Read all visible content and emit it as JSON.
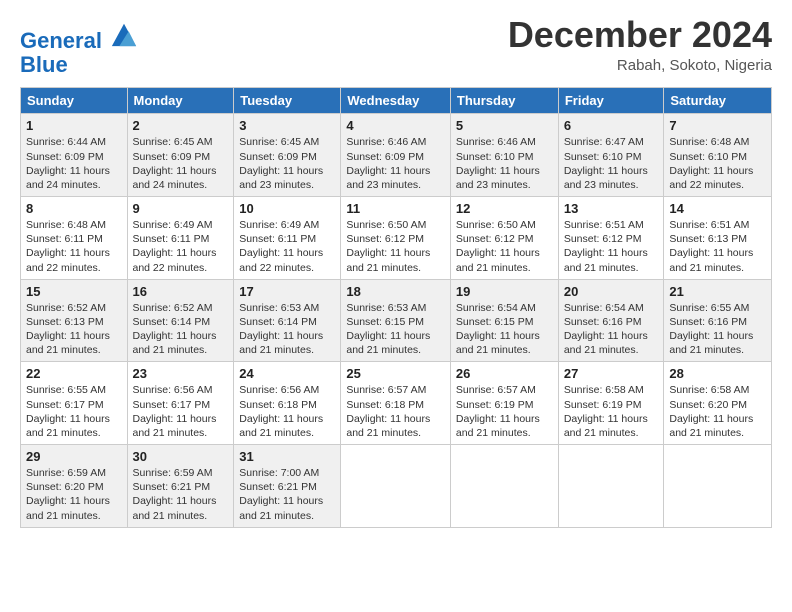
{
  "header": {
    "logo_line1": "General",
    "logo_line2": "Blue",
    "month": "December 2024",
    "location": "Rabah, Sokoto, Nigeria"
  },
  "days_of_week": [
    "Sunday",
    "Monday",
    "Tuesday",
    "Wednesday",
    "Thursday",
    "Friday",
    "Saturday"
  ],
  "weeks": [
    [
      {
        "day": "1",
        "sunrise": "6:44 AM",
        "sunset": "6:09 PM",
        "daylight": "11 hours and 24 minutes."
      },
      {
        "day": "2",
        "sunrise": "6:45 AM",
        "sunset": "6:09 PM",
        "daylight": "11 hours and 24 minutes."
      },
      {
        "day": "3",
        "sunrise": "6:45 AM",
        "sunset": "6:09 PM",
        "daylight": "11 hours and 23 minutes."
      },
      {
        "day": "4",
        "sunrise": "6:46 AM",
        "sunset": "6:09 PM",
        "daylight": "11 hours and 23 minutes."
      },
      {
        "day": "5",
        "sunrise": "6:46 AM",
        "sunset": "6:10 PM",
        "daylight": "11 hours and 23 minutes."
      },
      {
        "day": "6",
        "sunrise": "6:47 AM",
        "sunset": "6:10 PM",
        "daylight": "11 hours and 23 minutes."
      },
      {
        "day": "7",
        "sunrise": "6:48 AM",
        "sunset": "6:10 PM",
        "daylight": "11 hours and 22 minutes."
      }
    ],
    [
      {
        "day": "8",
        "sunrise": "6:48 AM",
        "sunset": "6:11 PM",
        "daylight": "11 hours and 22 minutes."
      },
      {
        "day": "9",
        "sunrise": "6:49 AM",
        "sunset": "6:11 PM",
        "daylight": "11 hours and 22 minutes."
      },
      {
        "day": "10",
        "sunrise": "6:49 AM",
        "sunset": "6:11 PM",
        "daylight": "11 hours and 22 minutes."
      },
      {
        "day": "11",
        "sunrise": "6:50 AM",
        "sunset": "6:12 PM",
        "daylight": "11 hours and 21 minutes."
      },
      {
        "day": "12",
        "sunrise": "6:50 AM",
        "sunset": "6:12 PM",
        "daylight": "11 hours and 21 minutes."
      },
      {
        "day": "13",
        "sunrise": "6:51 AM",
        "sunset": "6:12 PM",
        "daylight": "11 hours and 21 minutes."
      },
      {
        "day": "14",
        "sunrise": "6:51 AM",
        "sunset": "6:13 PM",
        "daylight": "11 hours and 21 minutes."
      }
    ],
    [
      {
        "day": "15",
        "sunrise": "6:52 AM",
        "sunset": "6:13 PM",
        "daylight": "11 hours and 21 minutes."
      },
      {
        "day": "16",
        "sunrise": "6:52 AM",
        "sunset": "6:14 PM",
        "daylight": "11 hours and 21 minutes."
      },
      {
        "day": "17",
        "sunrise": "6:53 AM",
        "sunset": "6:14 PM",
        "daylight": "11 hours and 21 minutes."
      },
      {
        "day": "18",
        "sunrise": "6:53 AM",
        "sunset": "6:15 PM",
        "daylight": "11 hours and 21 minutes."
      },
      {
        "day": "19",
        "sunrise": "6:54 AM",
        "sunset": "6:15 PM",
        "daylight": "11 hours and 21 minutes."
      },
      {
        "day": "20",
        "sunrise": "6:54 AM",
        "sunset": "6:16 PM",
        "daylight": "11 hours and 21 minutes."
      },
      {
        "day": "21",
        "sunrise": "6:55 AM",
        "sunset": "6:16 PM",
        "daylight": "11 hours and 21 minutes."
      }
    ],
    [
      {
        "day": "22",
        "sunrise": "6:55 AM",
        "sunset": "6:17 PM",
        "daylight": "11 hours and 21 minutes."
      },
      {
        "day": "23",
        "sunrise": "6:56 AM",
        "sunset": "6:17 PM",
        "daylight": "11 hours and 21 minutes."
      },
      {
        "day": "24",
        "sunrise": "6:56 AM",
        "sunset": "6:18 PM",
        "daylight": "11 hours and 21 minutes."
      },
      {
        "day": "25",
        "sunrise": "6:57 AM",
        "sunset": "6:18 PM",
        "daylight": "11 hours and 21 minutes."
      },
      {
        "day": "26",
        "sunrise": "6:57 AM",
        "sunset": "6:19 PM",
        "daylight": "11 hours and 21 minutes."
      },
      {
        "day": "27",
        "sunrise": "6:58 AM",
        "sunset": "6:19 PM",
        "daylight": "11 hours and 21 minutes."
      },
      {
        "day": "28",
        "sunrise": "6:58 AM",
        "sunset": "6:20 PM",
        "daylight": "11 hours and 21 minutes."
      }
    ],
    [
      {
        "day": "29",
        "sunrise": "6:59 AM",
        "sunset": "6:20 PM",
        "daylight": "11 hours and 21 minutes."
      },
      {
        "day": "30",
        "sunrise": "6:59 AM",
        "sunset": "6:21 PM",
        "daylight": "11 hours and 21 minutes."
      },
      {
        "day": "31",
        "sunrise": "7:00 AM",
        "sunset": "6:21 PM",
        "daylight": "11 hours and 21 minutes."
      },
      null,
      null,
      null,
      null
    ]
  ]
}
